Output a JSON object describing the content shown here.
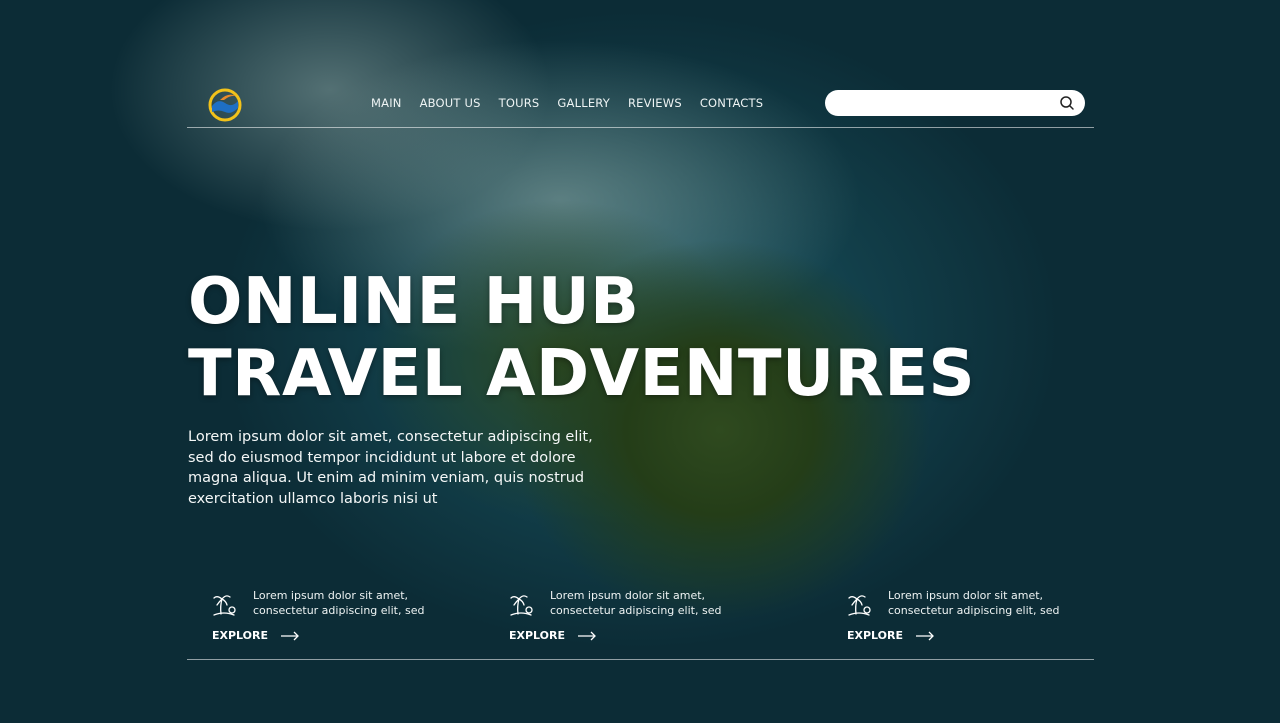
{
  "nav": {
    "items": [
      {
        "label": "MAIN"
      },
      {
        "label": "ABOUT US"
      },
      {
        "label": "TOURS"
      },
      {
        "label": "GALLERY"
      },
      {
        "label": "REVIEWS"
      },
      {
        "label": "CONTACTS"
      }
    ]
  },
  "search": {
    "placeholder": "",
    "icon": "search-icon"
  },
  "hero": {
    "title_line1": "ONLINE HUB",
    "title_line2": "TRAVEL ADVENTURES",
    "text": "Lorem ipsum dolor sit amet, consectetur adipiscing elit, sed do eiusmod tempor incididunt ut labore et dolore magna aliqua. Ut enim ad minim veniam, quis nostrud exercitation ullamco laboris nisi ut"
  },
  "features": [
    {
      "text": "Lorem ipsum dolor sit amet, consectetur adipiscing elit, sed",
      "cta": "EXPLORE",
      "icon": "island-palm-icon"
    },
    {
      "text": "Lorem ipsum dolor sit amet, consectetur adipiscing elit, sed",
      "cta": "EXPLORE",
      "icon": "island-palm-icon"
    },
    {
      "text": "Lorem ipsum dolor sit amet, consectetur adipiscing elit, sed",
      "cta": "EXPLORE",
      "icon": "island-palm-icon"
    }
  ],
  "colors": {
    "logo_blue": "#1e6fc4",
    "logo_yellow": "#f2c21a",
    "logo_orange": "#e8892a",
    "ocean_dark": "#0b2631"
  }
}
